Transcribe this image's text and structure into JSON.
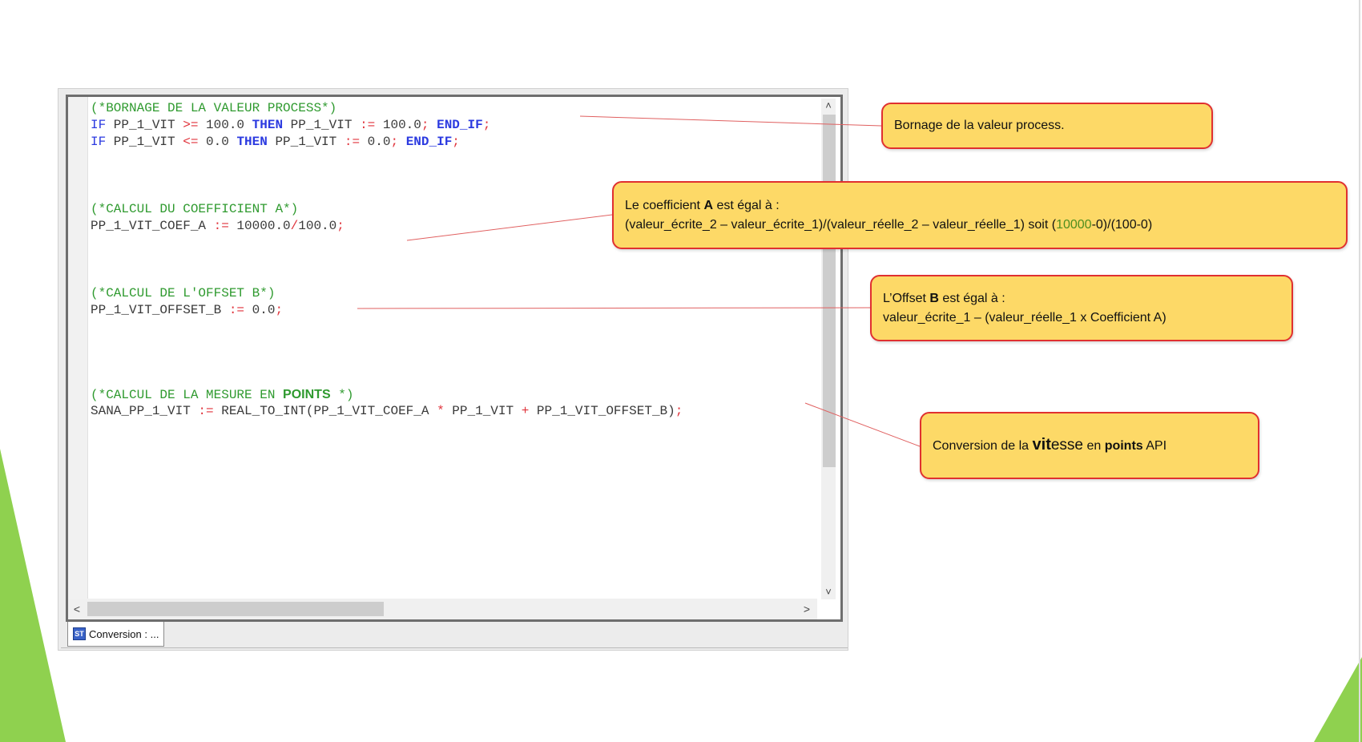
{
  "editor": {
    "code_lines": [
      [
        {
          "c": "cm",
          "t": "(*BORNAGE DE LA VALEUR PROCESS*)"
        }
      ],
      [
        {
          "c": "kw",
          "t": "IF"
        },
        {
          "c": "id",
          "t": " PP_1_VIT "
        },
        {
          "c": "op",
          "t": ">="
        },
        {
          "c": "id",
          "t": " 100.0 "
        },
        {
          "c": "kw-b",
          "t": "THEN"
        },
        {
          "c": "id",
          "t": " PP_1_VIT "
        },
        {
          "c": "op",
          "t": ":="
        },
        {
          "c": "id",
          "t": " 100.0"
        },
        {
          "c": "op",
          "t": ";"
        },
        {
          "c": "id",
          "t": " "
        },
        {
          "c": "kw-b",
          "t": "END_IF"
        },
        {
          "c": "op",
          "t": ";"
        }
      ],
      [
        {
          "c": "kw",
          "t": "IF"
        },
        {
          "c": "id",
          "t": " PP_1_VIT "
        },
        {
          "c": "op",
          "t": "<="
        },
        {
          "c": "id",
          "t": " 0.0 "
        },
        {
          "c": "kw-b",
          "t": "THEN"
        },
        {
          "c": "id",
          "t": " PP_1_VIT "
        },
        {
          "c": "op",
          "t": ":="
        },
        {
          "c": "id",
          "t": " 0.0"
        },
        {
          "c": "op",
          "t": ";"
        },
        {
          "c": "id",
          "t": " "
        },
        {
          "c": "kw-b",
          "t": "END_IF"
        },
        {
          "c": "op",
          "t": ";"
        }
      ],
      [],
      [],
      [],
      [
        {
          "c": "cm",
          "t": "(*CALCUL DU COEFFICIENT A*)"
        }
      ],
      [
        {
          "c": "id",
          "t": "PP_1_VIT_COEF_A "
        },
        {
          "c": "op",
          "t": ":="
        },
        {
          "c": "id",
          "t": " 10000.0"
        },
        {
          "c": "op",
          "t": "/"
        },
        {
          "c": "id",
          "t": "100.0"
        },
        {
          "c": "op",
          "t": ";"
        }
      ],
      [],
      [],
      [],
      [
        {
          "c": "cm",
          "t": "(*CALCUL DE L'OFFSET B*)"
        }
      ],
      [
        {
          "c": "id",
          "t": "PP_1_VIT_OFFSET_B "
        },
        {
          "c": "op",
          "t": ":="
        },
        {
          "c": "id",
          "t": " 0.0"
        },
        {
          "c": "op",
          "t": ";"
        }
      ],
      [],
      [],
      [],
      [],
      [
        {
          "c": "cm",
          "t": "(*CALCUL DE LA MESURE EN "
        },
        {
          "c": "cm-b",
          "t": "POINTS"
        },
        {
          "c": "cm",
          "t": " *)"
        }
      ],
      [
        {
          "c": "id",
          "t": "SANA_PP_1_VIT "
        },
        {
          "c": "op",
          "t": ":="
        },
        {
          "c": "id",
          "t": " REAL_TO_INT(PP_1_VIT_COEF_A "
        },
        {
          "c": "op",
          "t": "*"
        },
        {
          "c": "id",
          "t": " PP_1_VIT "
        },
        {
          "c": "op",
          "t": "+"
        },
        {
          "c": "id",
          "t": " PP_1_VIT_OFFSET_B)"
        },
        {
          "c": "op",
          "t": ";"
        }
      ]
    ],
    "scroll_up": "˄",
    "scroll_down": "˅",
    "scroll_left": "<",
    "scroll_right": ">"
  },
  "tab": {
    "icon_label": "ST",
    "label": "Conversion : ..."
  },
  "callouts": {
    "bornage": "Bornage de la valeur process.",
    "coef_prefix": "Le coefficient ",
    "coef_bold": "A",
    "coef_suffix": " est égal à :",
    "coef_line2_a": "(valeur_écrite_2 – valeur_écrite_1)/(valeur_réelle_2 – valeur_réelle_1) soit (",
    "coef_line2_num": "10000",
    "coef_line2_b": "-0)/(100-0)",
    "offset_prefix": "L’Offset ",
    "offset_bold": "B",
    "offset_suffix": " est égal à :",
    "offset_line2": "valeur_écrite_1 – (valeur_réelle_1 x Coefficient A)",
    "conv_a": "Conversion de la ",
    "conv_big": "vit",
    "conv_b": "esse",
    "conv_c": " en ",
    "conv_bold": "points",
    "conv_d": " API"
  },
  "colors": {
    "callout_fill": "#fdd967",
    "callout_border": "#e03030",
    "comment": "#2f9a2f",
    "keyword": "#2b3ae0",
    "operator": "#e0343c",
    "slide_accent": "#8fd14f"
  }
}
